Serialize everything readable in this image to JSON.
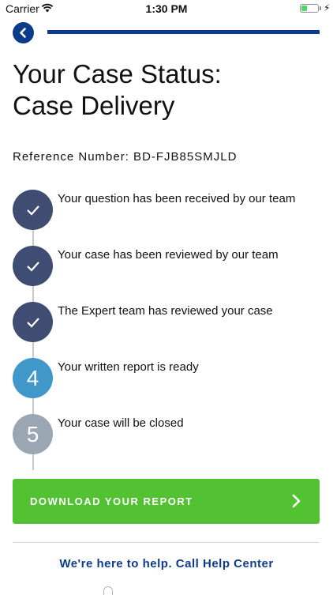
{
  "status_bar": {
    "carrier": "Carrier",
    "time": "1:30 PM",
    "battery_level": 0.3
  },
  "progress": {
    "value": 1.0
  },
  "title_line1": "Your Case Status:",
  "title_line2": "Case Delivery",
  "reference": "Reference Number: BD-FJB85SMJLD",
  "steps": [
    {
      "state": "done",
      "label": "Your question has been received by our team"
    },
    {
      "state": "done",
      "label": "Your case has been reviewed by our team"
    },
    {
      "state": "done",
      "label": "The Expert team has reviewed your case"
    },
    {
      "state": "active",
      "number": "4",
      "label": "Your written report is ready"
    },
    {
      "state": "pending",
      "number": "5",
      "label": "Your case will be closed"
    }
  ],
  "download_label": "DOWNLOAD YOUR REPORT",
  "help_text": "We're here to help. Call Help Center",
  "colors": {
    "brand": "#0d3b8c",
    "done": "#3f4d72",
    "active": "#3f98c9",
    "pending": "#9aa6b2",
    "cta": "#53c232"
  },
  "icons": {
    "back": "chevron-left-icon",
    "done": "check-icon",
    "cta": "chevron-right-icon"
  }
}
